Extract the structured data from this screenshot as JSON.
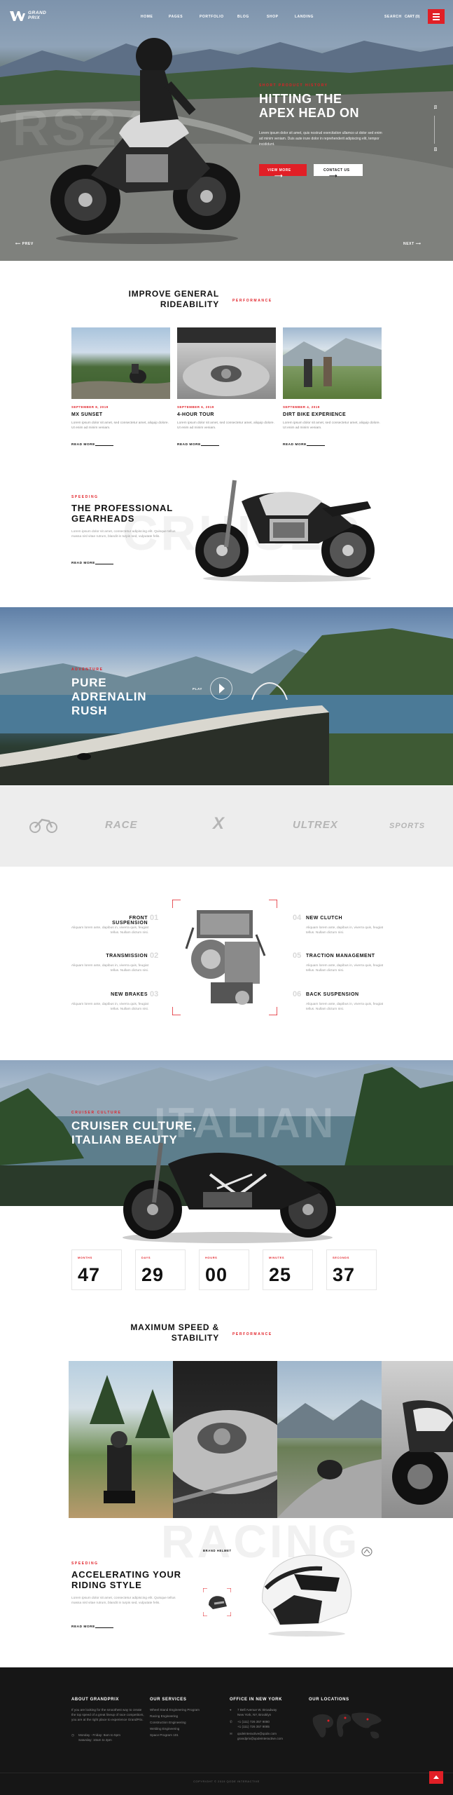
{
  "brand": {
    "line1": "GRAND",
    "line2": "PRIX",
    "accent": "#e11f26"
  },
  "nav": {
    "items": [
      "HOME",
      "PAGES",
      "PORTFOLIO",
      "BLOG",
      "SHOP",
      "LANDING"
    ],
    "search": "SEARCH",
    "cart": "CART (0)"
  },
  "hero": {
    "bg_text": "RS24",
    "eyebrow": "SHORT PRODUCT HISTORY",
    "title_line1": "HITTING THE",
    "title_line2": "APEX HEAD ON",
    "text": "Lorem ipsum dolor sit amet, quis nostrud exercitation ullamco ut dolor sed enim ad minim veniam. Duis aute irure dolor in reprehenderit adipiscing elit, tempor incididunt.",
    "btn_primary": "VIEW MORE",
    "btn_secondary": "CONTACT US",
    "slide_current": "01",
    "slide_total": "03",
    "prev": "PREV",
    "next": "NEXT"
  },
  "improve": {
    "title_line1": "IMPROVE GENERAL",
    "title_line2": "RIDEABILITY",
    "tag": "PERFORMANCE",
    "cards": [
      {
        "date": "SEPTEMBER 8, 2019",
        "title": "MX SUNSET",
        "text": "Lorem ipsum dolor sit amet, sed consectetur amet, aliquip dolore. Ut enim ad minim veniam.",
        "more": "READ MORE"
      },
      {
        "date": "SEPTEMBER 6, 2019",
        "title": "4-HOUR TOUR",
        "text": "Lorem ipsum dolor sit amet, sed consectetur amet, aliquip dolore. Ut enim ad minim veniam.",
        "more": "READ MORE"
      },
      {
        "date": "SEPTEMBER 4, 2019",
        "title": "DIRT BIKE EXPERIENCE",
        "text": "Lorem ipsum dolor sit amet, sed consectetur amet, aliquip dolore. Ut enim ad minim veniam.",
        "more": "READ MORE"
      }
    ]
  },
  "gearheads": {
    "eyebrow": "SPEEDING",
    "title_line1": "THE PROFESSIONAL",
    "title_line2": "GEARHEADS",
    "bg_text": "CRUISER",
    "text": "Lorem ipsum dolor sit amet, consectetur adipiscing elit. Quisque tellus massa nisl vitae rutrum, blandit in turpis sed, vulputate felis.",
    "more": "READ MORE"
  },
  "adrenalin": {
    "eyebrow": "ADVENTURE",
    "title_line1": "PURE",
    "title_line2": "ADRENALIN",
    "title_line3": "RUSH",
    "play": "PLAY"
  },
  "brands": [
    "RACE",
    "X",
    "ULTREX",
    "SPORTS"
  ],
  "features": {
    "left": [
      {
        "num": "01",
        "title": "FRONT SUSPENSION",
        "text": "Aliquam lorem ante, dapibus in, viverra quis, feugiat tellus. Nullam dictum nisi."
      },
      {
        "num": "02",
        "title": "TRANSMISSION",
        "text": "Aliquam lorem ante, dapibus in, viverra quis, feugiat tellus. Nullam dictum nisi."
      },
      {
        "num": "03",
        "title": "NEW BRAKES",
        "text": "Aliquam lorem ante, dapibus in, viverra quis, feugiat tellus. Nullam dictum nisi."
      }
    ],
    "right": [
      {
        "num": "04",
        "title": "NEW CLUTCH",
        "text": "Aliquam lorem ante, dapibus in, viverra quis, feugiat tellus. Nullam dictum nisi."
      },
      {
        "num": "05",
        "title": "TRACTION MANAGEMENT",
        "text": "Aliquam lorem ante, dapibus in, viverra quis, feugiat tellus. Nullam dictum nisi."
      },
      {
        "num": "06",
        "title": "BACK SUSPENSION",
        "text": "Aliquam lorem ante, dapibus in, viverra quis, feugiat tellus. Nullam dictum nisi."
      }
    ]
  },
  "cruiser": {
    "eyebrow": "CRUISER CULTURE",
    "bg_text": "ITALIAN",
    "title_line1": "CRUISER CULTURE,",
    "title_line2": "ITALIAN BEAUTY"
  },
  "counters": [
    {
      "label": "MONTHS",
      "value": "47"
    },
    {
      "label": "DAYS",
      "value": "29"
    },
    {
      "label": "HOURS",
      "value": "00"
    },
    {
      "label": "MINUTES",
      "value": "25"
    },
    {
      "label": "SECONDS",
      "value": "37"
    }
  ],
  "speed": {
    "title_line1": "MAXIMUM SPEED &",
    "title_line2": "STABILITY",
    "tag": "PERFORMANCE"
  },
  "riding": {
    "eyebrow": "SPEEDING",
    "title_line1": "ACCELERATING YOUR",
    "title_line2": "RIDING STYLE",
    "bg_text": "RACING",
    "thumb_label": "BRAND HELMET",
    "text": "Lorem ipsum dolor sit amet, consectetur adipiscing elit. Quisque tellus massa nisl vitae rutrum, blandit in turpis sed, vulputate felis.",
    "more": "READ MORE"
  },
  "footer": {
    "about_title": "ABOUT GRANDPRIX",
    "about_text": "If you are looking for the smoothest way to create the top speed of a great lineup of race competitors, you are at the right place to experience GrandPrix.",
    "hours": "Monday - Friday: 9am to 5pm",
    "hours2": "Saturday: 10am to 2pm",
    "services_title": "OUR SERVICES",
    "services": [
      "Wheel Stand Engineering Program",
      "Racing Engineering",
      "Construction Engineering",
      "Welding Engineering",
      "Space Program 101"
    ],
    "office_title": "OFFICE IN NEW YORK",
    "office": [
      "7 Bell Avenue W. Broadway",
      "New York, NY, Brooklyn",
      "+1 (111) 726 357 9080",
      "+1 (111) 726 357 9085",
      "qodeinteractive@qode.com",
      "grandprix@qodeinteractive.com"
    ],
    "locations_title": "OUR LOCATIONS",
    "copyright": "COPYRIGHT © 2019 QODE INTERACTIVE"
  }
}
